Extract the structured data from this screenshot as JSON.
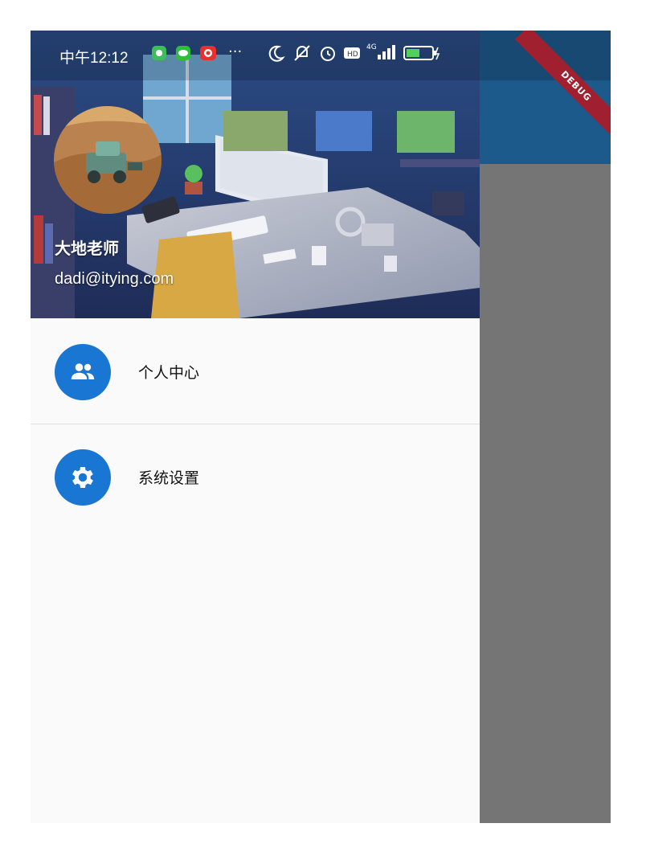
{
  "status_bar": {
    "time": "中午12:12",
    "more": "···",
    "network": "4G",
    "battery": "41"
  },
  "drawer": {
    "header": {
      "user_name": "大地老师",
      "user_email": "dadi@itying.com"
    },
    "items": [
      {
        "label": "个人中心",
        "icon": "people-icon"
      },
      {
        "label": "系统设置",
        "icon": "settings-icon"
      }
    ]
  },
  "debug_banner": "DEBUG",
  "colors": {
    "app_bar": "#1d5a8c",
    "scrim": "#757575",
    "menu_icon_bg": "#1976d2",
    "drawer_bg": "#fafafa",
    "debug_banner": "#a0202f"
  }
}
